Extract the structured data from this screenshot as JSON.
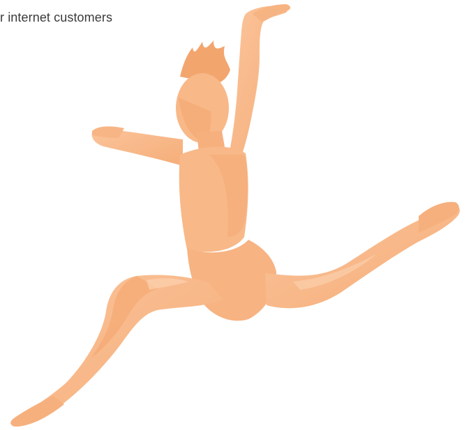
{
  "hero": {
    "tagline": "r internet customers",
    "image_icon": "leaping-dancer-silhouette",
    "tint_color": "#f9b98a",
    "shade_color": "#ef9e66",
    "highlight_color": "#fcd2b1"
  }
}
